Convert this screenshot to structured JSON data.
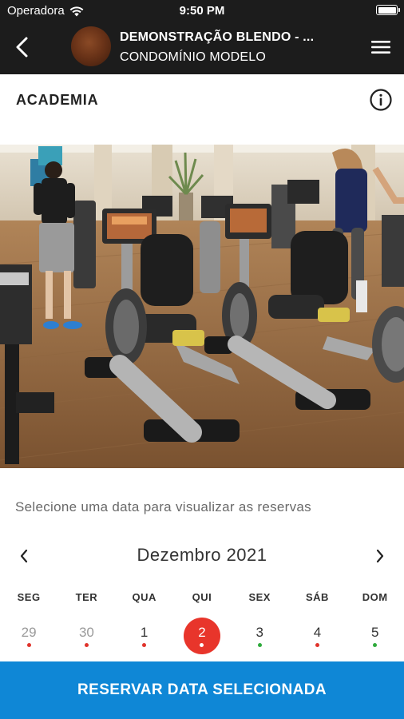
{
  "status_bar": {
    "carrier": "Operadora",
    "time": "9:50 PM",
    "icons": [
      "wifi-icon",
      "battery-icon"
    ]
  },
  "app_bar": {
    "back_icon": "back-arrow-icon",
    "condo_avatar": "condominium-logo",
    "title": "DEMONSTRAÇÃO BLENDO - ...",
    "subtitle": "CONDOMÍNIO MODELO",
    "menu_icon": "hamburger-menu-icon"
  },
  "section": {
    "title": "ACADEMIA",
    "info_icon": "info-icon"
  },
  "photo": {
    "subject": "gym-exercise-bikes"
  },
  "calendar": {
    "hint": "Selecione uma data para visualizar as reservas",
    "month_label": "Dezembro 2021",
    "prev_icon": "chevron-left-icon",
    "next_icon": "chevron-right-icon",
    "weekdays": [
      "SEG",
      "TER",
      "QUA",
      "QUI",
      "SEX",
      "SÁB",
      "DOM"
    ],
    "days": [
      {
        "number": "29",
        "in_month": false,
        "selected": false,
        "dot": "red"
      },
      {
        "number": "30",
        "in_month": false,
        "selected": false,
        "dot": "red"
      },
      {
        "number": "1",
        "in_month": true,
        "selected": false,
        "dot": "red"
      },
      {
        "number": "2",
        "in_month": true,
        "selected": true,
        "dot": "white"
      },
      {
        "number": "3",
        "in_month": true,
        "selected": false,
        "dot": "green"
      },
      {
        "number": "4",
        "in_month": true,
        "selected": false,
        "dot": "red"
      },
      {
        "number": "5",
        "in_month": true,
        "selected": false,
        "dot": "green"
      }
    ]
  },
  "colors": {
    "app_bar": "#1c1c1c",
    "selected_day": "#e8352b",
    "dot_red": "#e0332b",
    "dot_green": "#2eaa3c",
    "primary_button": "#0f87d6"
  },
  "action": {
    "reserve_label": "RESERVAR DATA SELECIONADA"
  }
}
